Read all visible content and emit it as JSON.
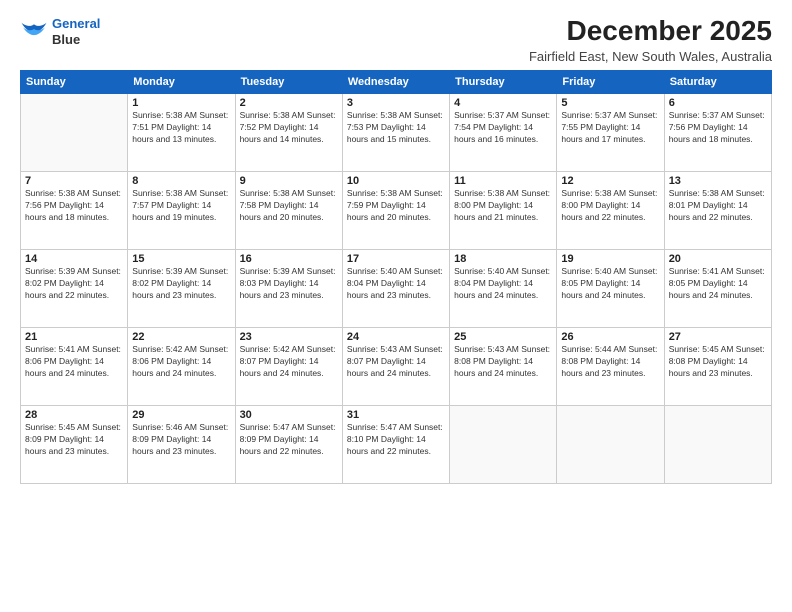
{
  "logo": {
    "line1": "General",
    "line2": "Blue"
  },
  "title": "December 2025",
  "location": "Fairfield East, New South Wales, Australia",
  "days_header": [
    "Sunday",
    "Monday",
    "Tuesday",
    "Wednesday",
    "Thursday",
    "Friday",
    "Saturday"
  ],
  "weeks": [
    [
      {
        "num": "",
        "info": ""
      },
      {
        "num": "1",
        "info": "Sunrise: 5:38 AM\nSunset: 7:51 PM\nDaylight: 14 hours\nand 13 minutes."
      },
      {
        "num": "2",
        "info": "Sunrise: 5:38 AM\nSunset: 7:52 PM\nDaylight: 14 hours\nand 14 minutes."
      },
      {
        "num": "3",
        "info": "Sunrise: 5:38 AM\nSunset: 7:53 PM\nDaylight: 14 hours\nand 15 minutes."
      },
      {
        "num": "4",
        "info": "Sunrise: 5:37 AM\nSunset: 7:54 PM\nDaylight: 14 hours\nand 16 minutes."
      },
      {
        "num": "5",
        "info": "Sunrise: 5:37 AM\nSunset: 7:55 PM\nDaylight: 14 hours\nand 17 minutes."
      },
      {
        "num": "6",
        "info": "Sunrise: 5:37 AM\nSunset: 7:56 PM\nDaylight: 14 hours\nand 18 minutes."
      }
    ],
    [
      {
        "num": "7",
        "info": "Sunrise: 5:38 AM\nSunset: 7:56 PM\nDaylight: 14 hours\nand 18 minutes."
      },
      {
        "num": "8",
        "info": "Sunrise: 5:38 AM\nSunset: 7:57 PM\nDaylight: 14 hours\nand 19 minutes."
      },
      {
        "num": "9",
        "info": "Sunrise: 5:38 AM\nSunset: 7:58 PM\nDaylight: 14 hours\nand 20 minutes."
      },
      {
        "num": "10",
        "info": "Sunrise: 5:38 AM\nSunset: 7:59 PM\nDaylight: 14 hours\nand 20 minutes."
      },
      {
        "num": "11",
        "info": "Sunrise: 5:38 AM\nSunset: 8:00 PM\nDaylight: 14 hours\nand 21 minutes."
      },
      {
        "num": "12",
        "info": "Sunrise: 5:38 AM\nSunset: 8:00 PM\nDaylight: 14 hours\nand 22 minutes."
      },
      {
        "num": "13",
        "info": "Sunrise: 5:38 AM\nSunset: 8:01 PM\nDaylight: 14 hours\nand 22 minutes."
      }
    ],
    [
      {
        "num": "14",
        "info": "Sunrise: 5:39 AM\nSunset: 8:02 PM\nDaylight: 14 hours\nand 22 minutes."
      },
      {
        "num": "15",
        "info": "Sunrise: 5:39 AM\nSunset: 8:02 PM\nDaylight: 14 hours\nand 23 minutes."
      },
      {
        "num": "16",
        "info": "Sunrise: 5:39 AM\nSunset: 8:03 PM\nDaylight: 14 hours\nand 23 minutes."
      },
      {
        "num": "17",
        "info": "Sunrise: 5:40 AM\nSunset: 8:04 PM\nDaylight: 14 hours\nand 23 minutes."
      },
      {
        "num": "18",
        "info": "Sunrise: 5:40 AM\nSunset: 8:04 PM\nDaylight: 14 hours\nand 24 minutes."
      },
      {
        "num": "19",
        "info": "Sunrise: 5:40 AM\nSunset: 8:05 PM\nDaylight: 14 hours\nand 24 minutes."
      },
      {
        "num": "20",
        "info": "Sunrise: 5:41 AM\nSunset: 8:05 PM\nDaylight: 14 hours\nand 24 minutes."
      }
    ],
    [
      {
        "num": "21",
        "info": "Sunrise: 5:41 AM\nSunset: 8:06 PM\nDaylight: 14 hours\nand 24 minutes."
      },
      {
        "num": "22",
        "info": "Sunrise: 5:42 AM\nSunset: 8:06 PM\nDaylight: 14 hours\nand 24 minutes."
      },
      {
        "num": "23",
        "info": "Sunrise: 5:42 AM\nSunset: 8:07 PM\nDaylight: 14 hours\nand 24 minutes."
      },
      {
        "num": "24",
        "info": "Sunrise: 5:43 AM\nSunset: 8:07 PM\nDaylight: 14 hours\nand 24 minutes."
      },
      {
        "num": "25",
        "info": "Sunrise: 5:43 AM\nSunset: 8:08 PM\nDaylight: 14 hours\nand 24 minutes."
      },
      {
        "num": "26",
        "info": "Sunrise: 5:44 AM\nSunset: 8:08 PM\nDaylight: 14 hours\nand 23 minutes."
      },
      {
        "num": "27",
        "info": "Sunrise: 5:45 AM\nSunset: 8:08 PM\nDaylight: 14 hours\nand 23 minutes."
      }
    ],
    [
      {
        "num": "28",
        "info": "Sunrise: 5:45 AM\nSunset: 8:09 PM\nDaylight: 14 hours\nand 23 minutes."
      },
      {
        "num": "29",
        "info": "Sunrise: 5:46 AM\nSunset: 8:09 PM\nDaylight: 14 hours\nand 23 minutes."
      },
      {
        "num": "30",
        "info": "Sunrise: 5:47 AM\nSunset: 8:09 PM\nDaylight: 14 hours\nand 22 minutes."
      },
      {
        "num": "31",
        "info": "Sunrise: 5:47 AM\nSunset: 8:10 PM\nDaylight: 14 hours\nand 22 minutes."
      },
      {
        "num": "",
        "info": ""
      },
      {
        "num": "",
        "info": ""
      },
      {
        "num": "",
        "info": ""
      }
    ]
  ]
}
